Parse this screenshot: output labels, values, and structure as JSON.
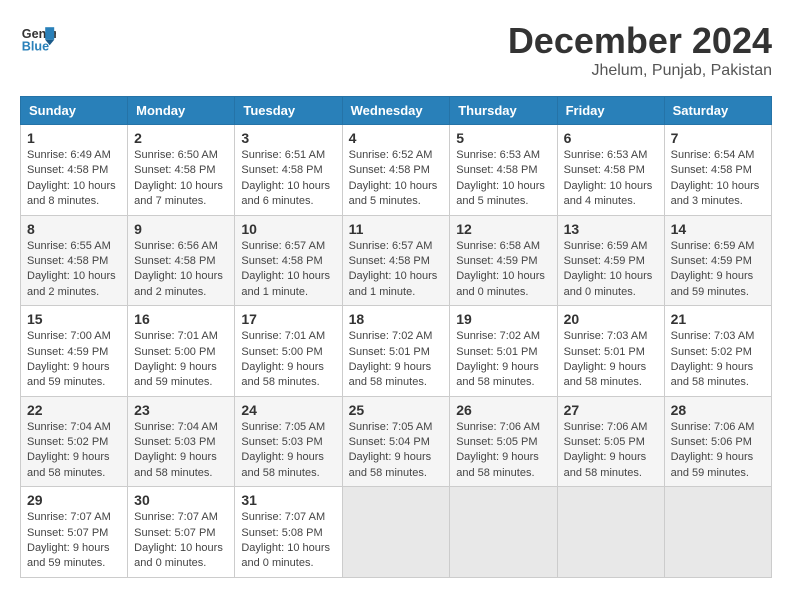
{
  "header": {
    "logo_line1": "General",
    "logo_line2": "Blue",
    "month": "December 2024",
    "location": "Jhelum, Punjab, Pakistan"
  },
  "weekdays": [
    "Sunday",
    "Monday",
    "Tuesday",
    "Wednesday",
    "Thursday",
    "Friday",
    "Saturday"
  ],
  "weeks": [
    [
      {
        "day": "1",
        "info": "Sunrise: 6:49 AM\nSunset: 4:58 PM\nDaylight: 10 hours and 8 minutes."
      },
      {
        "day": "2",
        "info": "Sunrise: 6:50 AM\nSunset: 4:58 PM\nDaylight: 10 hours and 7 minutes."
      },
      {
        "day": "3",
        "info": "Sunrise: 6:51 AM\nSunset: 4:58 PM\nDaylight: 10 hours and 6 minutes."
      },
      {
        "day": "4",
        "info": "Sunrise: 6:52 AM\nSunset: 4:58 PM\nDaylight: 10 hours and 5 minutes."
      },
      {
        "day": "5",
        "info": "Sunrise: 6:53 AM\nSunset: 4:58 PM\nDaylight: 10 hours and 5 minutes."
      },
      {
        "day": "6",
        "info": "Sunrise: 6:53 AM\nSunset: 4:58 PM\nDaylight: 10 hours and 4 minutes."
      },
      {
        "day": "7",
        "info": "Sunrise: 6:54 AM\nSunset: 4:58 PM\nDaylight: 10 hours and 3 minutes."
      }
    ],
    [
      {
        "day": "8",
        "info": "Sunrise: 6:55 AM\nSunset: 4:58 PM\nDaylight: 10 hours and 2 minutes."
      },
      {
        "day": "9",
        "info": "Sunrise: 6:56 AM\nSunset: 4:58 PM\nDaylight: 10 hours and 2 minutes."
      },
      {
        "day": "10",
        "info": "Sunrise: 6:57 AM\nSunset: 4:58 PM\nDaylight: 10 hours and 1 minute."
      },
      {
        "day": "11",
        "info": "Sunrise: 6:57 AM\nSunset: 4:58 PM\nDaylight: 10 hours and 1 minute."
      },
      {
        "day": "12",
        "info": "Sunrise: 6:58 AM\nSunset: 4:59 PM\nDaylight: 10 hours and 0 minutes."
      },
      {
        "day": "13",
        "info": "Sunrise: 6:59 AM\nSunset: 4:59 PM\nDaylight: 10 hours and 0 minutes."
      },
      {
        "day": "14",
        "info": "Sunrise: 6:59 AM\nSunset: 4:59 PM\nDaylight: 9 hours and 59 minutes."
      }
    ],
    [
      {
        "day": "15",
        "info": "Sunrise: 7:00 AM\nSunset: 4:59 PM\nDaylight: 9 hours and 59 minutes."
      },
      {
        "day": "16",
        "info": "Sunrise: 7:01 AM\nSunset: 5:00 PM\nDaylight: 9 hours and 59 minutes."
      },
      {
        "day": "17",
        "info": "Sunrise: 7:01 AM\nSunset: 5:00 PM\nDaylight: 9 hours and 58 minutes."
      },
      {
        "day": "18",
        "info": "Sunrise: 7:02 AM\nSunset: 5:01 PM\nDaylight: 9 hours and 58 minutes."
      },
      {
        "day": "19",
        "info": "Sunrise: 7:02 AM\nSunset: 5:01 PM\nDaylight: 9 hours and 58 minutes."
      },
      {
        "day": "20",
        "info": "Sunrise: 7:03 AM\nSunset: 5:01 PM\nDaylight: 9 hours and 58 minutes."
      },
      {
        "day": "21",
        "info": "Sunrise: 7:03 AM\nSunset: 5:02 PM\nDaylight: 9 hours and 58 minutes."
      }
    ],
    [
      {
        "day": "22",
        "info": "Sunrise: 7:04 AM\nSunset: 5:02 PM\nDaylight: 9 hours and 58 minutes."
      },
      {
        "day": "23",
        "info": "Sunrise: 7:04 AM\nSunset: 5:03 PM\nDaylight: 9 hours and 58 minutes."
      },
      {
        "day": "24",
        "info": "Sunrise: 7:05 AM\nSunset: 5:03 PM\nDaylight: 9 hours and 58 minutes."
      },
      {
        "day": "25",
        "info": "Sunrise: 7:05 AM\nSunset: 5:04 PM\nDaylight: 9 hours and 58 minutes."
      },
      {
        "day": "26",
        "info": "Sunrise: 7:06 AM\nSunset: 5:05 PM\nDaylight: 9 hours and 58 minutes."
      },
      {
        "day": "27",
        "info": "Sunrise: 7:06 AM\nSunset: 5:05 PM\nDaylight: 9 hours and 58 minutes."
      },
      {
        "day": "28",
        "info": "Sunrise: 7:06 AM\nSunset: 5:06 PM\nDaylight: 9 hours and 59 minutes."
      }
    ],
    [
      {
        "day": "29",
        "info": "Sunrise: 7:07 AM\nSunset: 5:07 PM\nDaylight: 9 hours and 59 minutes."
      },
      {
        "day": "30",
        "info": "Sunrise: 7:07 AM\nSunset: 5:07 PM\nDaylight: 10 hours and 0 minutes."
      },
      {
        "day": "31",
        "info": "Sunrise: 7:07 AM\nSunset: 5:08 PM\nDaylight: 10 hours and 0 minutes."
      },
      null,
      null,
      null,
      null
    ]
  ]
}
